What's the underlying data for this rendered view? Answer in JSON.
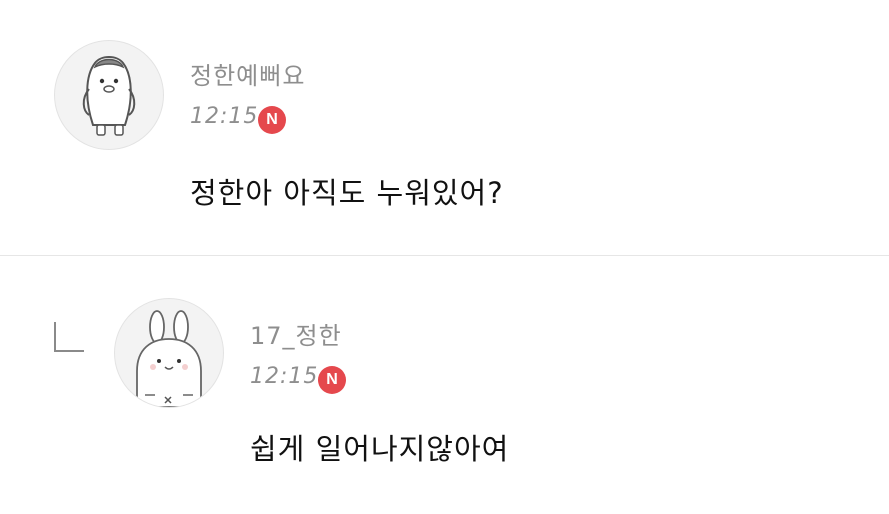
{
  "comments": [
    {
      "author": "정한예뻐요",
      "time": "12:15",
      "badge": "N",
      "message": "정한아 아직도 누워있어?",
      "avatar_icon": "penguin-icon"
    },
    {
      "author": "17_정한",
      "time": "12:15",
      "badge": "N",
      "message": "쉽게 일어나지않아여",
      "avatar_icon": "rabbit-icon",
      "is_reply": true
    }
  ],
  "colors": {
    "meta_text": "#8e8e8e",
    "message_text": "#111111",
    "new_badge": "#e5484d",
    "divider": "#e6e6e6"
  }
}
